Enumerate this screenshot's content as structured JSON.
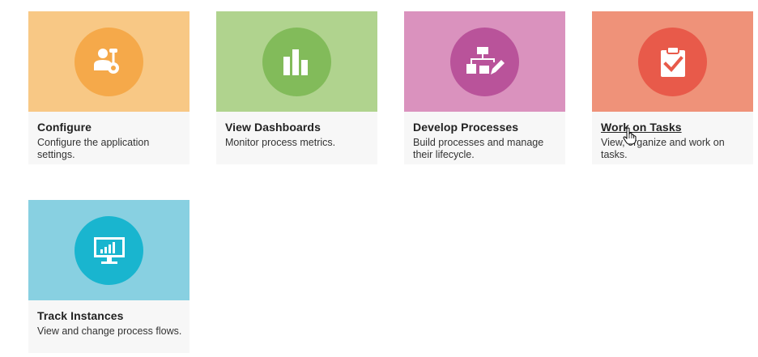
{
  "tiles": [
    {
      "key": "configure",
      "title": "Configure",
      "description": "Configure the application settings.",
      "banner_color": "#f8c885",
      "circle_color": "#f5a94a",
      "icon": "user-wrench-icon"
    },
    {
      "key": "dashboards",
      "title": "View Dashboards",
      "description": "Monitor process metrics.",
      "banner_color": "#b0d38e",
      "circle_color": "#82bb5a",
      "icon": "bar-chart-icon"
    },
    {
      "key": "processes",
      "title": "Develop Processes",
      "description": "Build processes and manage their lifecycle.",
      "banner_color": "#da92be",
      "circle_color": "#b9539a",
      "icon": "flowchart-edit-icon"
    },
    {
      "key": "tasks",
      "title": "Work on Tasks",
      "description": "View, organize and work on tasks.",
      "banner_color": "#ef9279",
      "circle_color": "#e85a4a",
      "icon": "clipboard-check-icon"
    },
    {
      "key": "instances",
      "title": "Track Instances",
      "description": "View and change process flows.",
      "banner_color": "#88d0e1",
      "circle_color": "#19b5cf",
      "icon": "monitor-chart-icon"
    }
  ],
  "hovered_tile": "tasks"
}
